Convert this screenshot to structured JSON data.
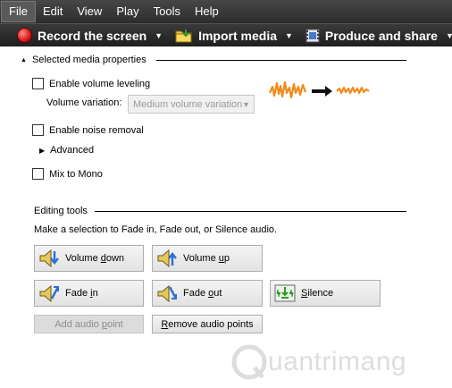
{
  "menubar": {
    "items": [
      {
        "label": "File",
        "active": true
      },
      {
        "label": "Edit"
      },
      {
        "label": "View"
      },
      {
        "label": "Play"
      },
      {
        "label": "Tools"
      },
      {
        "label": "Help"
      }
    ]
  },
  "toolbar": {
    "record": {
      "label": "Record the screen",
      "icon": "record-icon"
    },
    "import": {
      "label": "Import media",
      "icon": "folder-icon"
    },
    "produce": {
      "label": "Produce and share",
      "icon": "film-icon"
    },
    "overflow_icon": "overflow-icon"
  },
  "media_properties": {
    "header": "Selected media properties",
    "enable_volume_leveling": {
      "label": "Enable volume leveling",
      "checked": false
    },
    "volume_variation": {
      "label": "Volume variation:",
      "value": "Medium volume variation",
      "disabled": true
    },
    "enable_noise_removal": {
      "label": "Enable noise removal",
      "checked": false
    },
    "advanced": {
      "label": "Advanced"
    },
    "mix_to_mono": {
      "label": "Mix to Mono",
      "checked": false
    }
  },
  "editing_tools": {
    "header": "Editing tools",
    "instruction": "Make a selection to Fade in, Fade out, or Silence audio.",
    "buttons": {
      "volume_down": {
        "pre": "Volume ",
        "ul": "d",
        "post": "own"
      },
      "volume_up": {
        "pre": "Volume ",
        "ul": "u",
        "post": "p"
      },
      "fade_in": {
        "pre": "Fade ",
        "ul": "i",
        "post": "n"
      },
      "fade_out": {
        "pre": "Fade ",
        "ul": "o",
        "post": "ut"
      },
      "silence": {
        "pre": "",
        "ul": "S",
        "post": "ilence"
      }
    },
    "add_audio_point": {
      "pre": "Add audio ",
      "ul": "p",
      "post": "oint",
      "disabled": true
    },
    "remove_audio_points": {
      "pre": "",
      "ul": "R",
      "post": "emove audio points"
    }
  },
  "colors": {
    "menubar_bg": "#3b3b3b",
    "wave_orange": "#f28a1a"
  },
  "watermark": {
    "text": "uantrimang"
  }
}
